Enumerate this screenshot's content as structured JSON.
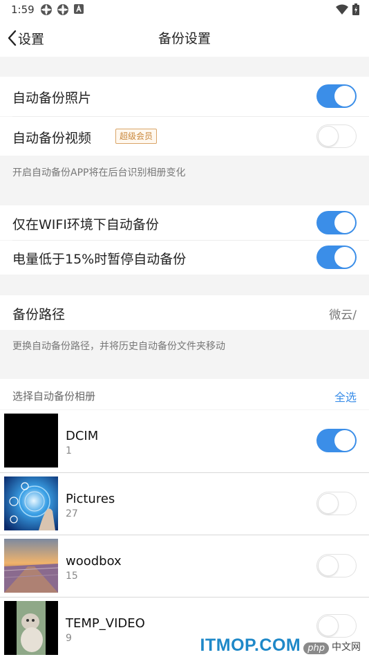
{
  "status_bar": {
    "time": "1:59",
    "icons": [
      "bike-icon",
      "bike-icon",
      "a-app-icon"
    ],
    "right_icons": [
      "wifi-icon",
      "battery-icon"
    ]
  },
  "nav": {
    "back_label": "设置",
    "title": "备份设置"
  },
  "auto_backup": {
    "photos_label": "自动备份照片",
    "photos_on": true,
    "videos_label": "自动备份视频",
    "videos_badge": "超级会员",
    "videos_on": false,
    "hint": "开启自动备份APP将在后台识别相册变化"
  },
  "conditions": {
    "wifi_label": "仅在WIFI环境下自动备份",
    "wifi_on": true,
    "battery_label": "电量低于15%时暂停自动备份",
    "battery_on": true
  },
  "path": {
    "label": "备份路径",
    "value": "微云/",
    "hint": "更换自动备份路径，并将历史自动备份文件夹移动"
  },
  "albums": {
    "header": "选择自动备份相册",
    "select_all": "全选",
    "items": [
      {
        "name": "DCIM",
        "count": "1",
        "on": true
      },
      {
        "name": "Pictures",
        "count": "27",
        "on": false
      },
      {
        "name": "woodbox",
        "count": "15",
        "on": false
      },
      {
        "name": "TEMP_VIDEO",
        "count": "9",
        "on": false
      }
    ]
  },
  "watermark": {
    "main": "ITMOP.COM",
    "php": "php",
    "cn": "中文网"
  },
  "colors": {
    "accent": "#3b8ee8",
    "badge": "#c9883c",
    "watermark": "#1e88c8"
  }
}
